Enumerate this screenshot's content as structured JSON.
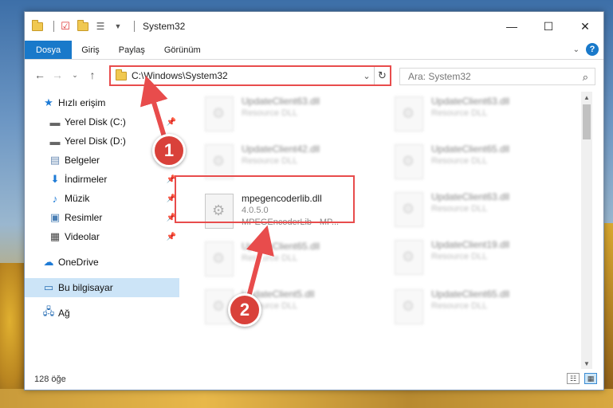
{
  "window": {
    "title": "System32",
    "controls": {
      "minimize": "—",
      "maximize": "☐",
      "close": "✕"
    }
  },
  "ribbon": {
    "tabs": [
      {
        "label": "Dosya",
        "active": true
      },
      {
        "label": "Giriş"
      },
      {
        "label": "Paylaş"
      },
      {
        "label": "Görünüm"
      }
    ],
    "help": "?"
  },
  "address": {
    "path": "C:\\Windows\\System32",
    "search_placeholder": "Ara: System32"
  },
  "sidebar": {
    "items": [
      {
        "label": "Hızlı erişim",
        "icon": "star-icon"
      },
      {
        "label": "Yerel Disk (C:)",
        "icon": "drive-icon",
        "pinned": true
      },
      {
        "label": "Yerel Disk (D:)",
        "icon": "drive-icon",
        "pinned": true
      },
      {
        "label": "Belgeler",
        "icon": "documents-icon",
        "pinned": true
      },
      {
        "label": "İndirmeler",
        "icon": "download-icon",
        "pinned": true
      },
      {
        "label": "Müzik",
        "icon": "music-icon",
        "pinned": true
      },
      {
        "label": "Resimler",
        "icon": "pictures-icon",
        "pinned": true
      },
      {
        "label": "Videolar",
        "icon": "videos-icon",
        "pinned": true
      },
      {
        "label": "OneDrive",
        "icon": "onedrive-icon"
      },
      {
        "label": "Bu bilgisayar",
        "icon": "computer-icon",
        "selected": true
      },
      {
        "label": "Ağ",
        "icon": "network-icon"
      }
    ]
  },
  "files": [
    {
      "name": "UpdateClient63.dll",
      "desc": "Resource DLL"
    },
    {
      "name": "UpdateClient63.dll",
      "desc": "Resource DLL"
    },
    {
      "name": "UpdateClient42.dll",
      "desc": "Resource DLL"
    },
    {
      "name": "UpdateClient65.dll",
      "desc": "Resource DLL"
    },
    {
      "name": "mpegencoderlib.dll",
      "version": "4.0.5.0",
      "desc": "MPEGEncoderLib - MP..."
    },
    {
      "name": "UpdateClient63.dll",
      "desc": "Resource DLL"
    },
    {
      "name": "UpdateClient65.dll",
      "desc": "Resource DLL"
    },
    {
      "name": "UpdateClient19.dll",
      "desc": "Resource DLL"
    },
    {
      "name": "UpdateClient5.dll",
      "desc": "Resource DLL"
    },
    {
      "name": "UpdateClient65.dll",
      "desc": "Resource DLL"
    }
  ],
  "status": {
    "count": "128 öğe"
  },
  "annotations": {
    "step1": "1",
    "step2": "2",
    "accent": "#e84c4c"
  }
}
